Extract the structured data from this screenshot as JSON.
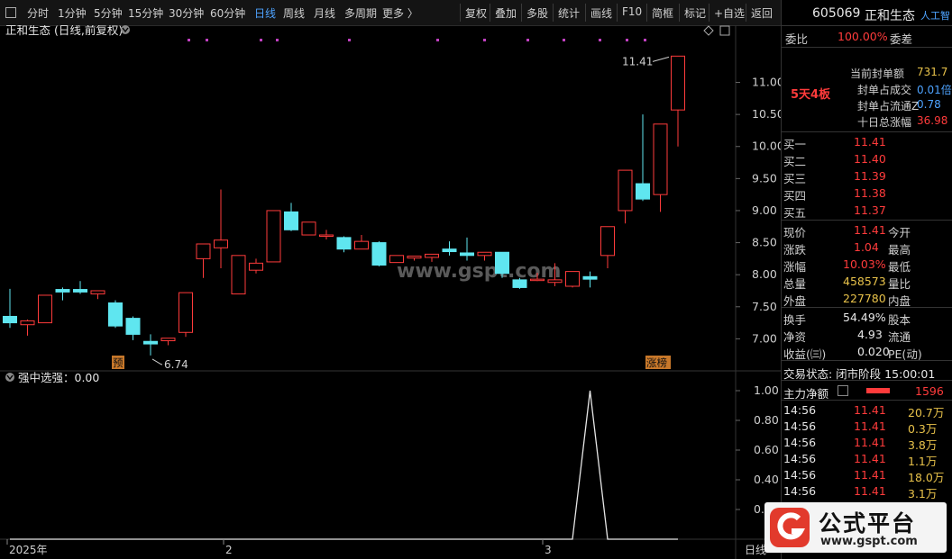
{
  "toolbar": {
    "items": [
      "分时",
      "1分钟",
      "5分钟",
      "15分钟",
      "30分钟",
      "60分钟",
      "日线",
      "周线",
      "月线",
      "多周期",
      "更多 〉"
    ],
    "active_index": 6,
    "right_items": [
      "复权",
      "叠加",
      "多股",
      "统计",
      "画线",
      "F10",
      "简框",
      "标记",
      "+自选",
      "返回"
    ]
  },
  "chart_title": "正和生态 (日线,前复权)",
  "indicator_title": "强中选强：0.00",
  "candles": [
    {
      "o": 7.35,
      "h": 7.78,
      "c": 7.25,
      "l": 7.17
    },
    {
      "o": 7.22,
      "h": 7.3,
      "c": 7.28,
      "l": 7.05
    },
    {
      "o": 7.25,
      "h": 7.68,
      "c": 7.68,
      "l": 7.25
    },
    {
      "o": 7.77,
      "h": 7.8,
      "c": 7.73,
      "l": 7.6
    },
    {
      "o": 7.77,
      "h": 7.9,
      "c": 7.73,
      "l": 7.7
    },
    {
      "o": 7.7,
      "h": 7.75,
      "c": 7.75,
      "l": 7.62
    },
    {
      "o": 7.56,
      "h": 7.6,
      "c": 7.2,
      "l": 7.17
    },
    {
      "o": 7.32,
      "h": 7.35,
      "c": 7.07,
      "l": 6.98
    },
    {
      "o": 6.96,
      "h": 7.07,
      "c": 6.92,
      "l": 6.74
    },
    {
      "o": 6.97,
      "h": 7.01,
      "c": 7.01,
      "l": 6.9
    },
    {
      "o": 7.1,
      "h": 7.72,
      "c": 7.72,
      "l": 7.03
    },
    {
      "o": 8.25,
      "h": 8.48,
      "c": 8.48,
      "l": 7.95
    },
    {
      "o": 8.42,
      "h": 9.33,
      "c": 8.54,
      "l": 8.1
    },
    {
      "o": 7.7,
      "h": 8.3,
      "c": 8.3,
      "l": 7.7
    },
    {
      "o": 8.07,
      "h": 8.25,
      "c": 8.18,
      "l": 8.02
    },
    {
      "o": 8.2,
      "h": 9.0,
      "c": 9.0,
      "l": 8.2
    },
    {
      "o": 8.98,
      "h": 9.12,
      "c": 8.7,
      "l": 8.68
    },
    {
      "o": 8.62,
      "h": 8.82,
      "c": 8.82,
      "l": 8.62
    },
    {
      "o": 8.62,
      "h": 8.7,
      "c": 8.62,
      "l": 8.55
    },
    {
      "o": 8.58,
      "h": 8.6,
      "c": 8.4,
      "l": 8.35
    },
    {
      "o": 8.4,
      "h": 8.62,
      "c": 8.52,
      "l": 8.4
    },
    {
      "o": 8.5,
      "h": 8.52,
      "c": 8.15,
      "l": 8.13
    },
    {
      "o": 8.19,
      "h": 8.3,
      "c": 8.3,
      "l": 8.19
    },
    {
      "o": 8.26,
      "h": 8.29,
      "c": 8.29,
      "l": 8.22
    },
    {
      "o": 8.27,
      "h": 8.32,
      "c": 8.32,
      "l": 8.2
    },
    {
      "o": 8.4,
      "h": 8.52,
      "c": 8.36,
      "l": 8.3
    },
    {
      "o": 8.34,
      "h": 8.58,
      "c": 8.3,
      "l": 8.22
    },
    {
      "o": 8.3,
      "h": 8.35,
      "c": 8.35,
      "l": 8.22
    },
    {
      "o": 8.35,
      "h": 8.35,
      "c": 8.02,
      "l": 7.95
    },
    {
      "o": 7.92,
      "h": 7.95,
      "c": 7.8,
      "l": 7.78
    },
    {
      "o": 7.93,
      "h": 8.03,
      "c": 7.93,
      "l": 7.9
    },
    {
      "o": 7.88,
      "h": 8.18,
      "c": 7.92,
      "l": 7.82
    },
    {
      "o": 7.82,
      "h": 8.05,
      "c": 8.05,
      "l": 7.8
    },
    {
      "o": 7.97,
      "h": 8.05,
      "c": 7.93,
      "l": 7.8
    },
    {
      "o": 8.3,
      "h": 8.75,
      "c": 8.75,
      "l": 8.1
    },
    {
      "o": 9.0,
      "h": 9.63,
      "c": 9.63,
      "l": 8.8
    },
    {
      "o": 9.42,
      "h": 10.5,
      "c": 9.18,
      "l": 9.15
    },
    {
      "o": 9.25,
      "h": 10.35,
      "c": 10.35,
      "l": 8.98
    },
    {
      "o": 10.57,
      "h": 11.41,
      "c": 11.41,
      "l": 10.0
    }
  ],
  "markers": {
    "high_label": "11.41",
    "low_label": "6.74",
    "tag_pre": "预",
    "tag_rank": "涨榜"
  },
  "price_axis": [
    "11.00",
    "10.50",
    "10.00",
    "9.50",
    "9.00",
    "8.50",
    "8.00",
    "7.50",
    "7.00"
  ],
  "indicator_axis": [
    "1.00",
    "0.80",
    "0.60",
    "0.40",
    "0.2"
  ],
  "indicator_values": [
    0,
    0,
    0,
    0,
    0,
    0,
    0,
    0,
    0,
    0,
    0,
    0,
    0,
    0,
    0,
    0,
    0,
    0,
    0,
    0,
    0,
    0,
    0,
    0,
    0,
    0,
    0,
    0,
    0,
    0,
    0,
    0,
    0,
    1,
    0,
    0,
    0,
    0,
    0
  ],
  "x_axis": {
    "labels": [
      "2025年",
      "2",
      "3"
    ],
    "right_label": "日线"
  },
  "watermark_text": "www.gspt.com",
  "panel": {
    "code": "605069",
    "name": "正和生态",
    "ai_label": "人工智",
    "weibi_label": "委比",
    "weibi_value": "100.00%",
    "weicha_label": "委差",
    "streak": "5天4板",
    "seal_lines": [
      {
        "label": "当前封单额",
        "value": "731.7"
      },
      {
        "label": "封单占成交",
        "value": "0.01倍"
      },
      {
        "label": "封单占流通Z",
        "value": "0.78"
      },
      {
        "label": "十日总涨幅",
        "value": "36.98"
      }
    ],
    "bids": [
      {
        "label": "买一",
        "price": "11.41"
      },
      {
        "label": "买二",
        "price": "11.40"
      },
      {
        "label": "买三",
        "price": "11.39"
      },
      {
        "label": "买四",
        "price": "11.38"
      },
      {
        "label": "买五",
        "price": "11.37"
      }
    ],
    "quote": [
      {
        "l1": "现价",
        "v1": "11.41",
        "l2": "今开"
      },
      {
        "l1": "涨跌",
        "v1": "1.04",
        "l2": "最高"
      },
      {
        "l1": "涨幅",
        "v1": "10.03%",
        "l2": "最低"
      },
      {
        "l1": "总量",
        "v1": "458573",
        "l2": "量比"
      },
      {
        "l1": "外盘",
        "v1": "227780",
        "l2": "内盘"
      }
    ],
    "stats": [
      {
        "l1": "换手",
        "v1": "54.49%",
        "l2": "股本"
      },
      {
        "l1": "净资",
        "v1": "4.93",
        "l2": "流通"
      },
      {
        "l1": "收益(㈢)",
        "v1": "0.020",
        "l2": "PE(动)"
      }
    ],
    "trade_status": "交易状态: 闭市阶段 15:00:01",
    "main_flow_label": "主力净额",
    "main_flow_value": "1596",
    "ticks": [
      {
        "time": "14:56",
        "price": "11.41",
        "vol": "20.7万"
      },
      {
        "time": "14:56",
        "price": "11.41",
        "vol": "0.3万"
      },
      {
        "time": "14:56",
        "price": "11.41",
        "vol": "3.8万"
      },
      {
        "time": "14:56",
        "price": "11.41",
        "vol": "1.1万"
      },
      {
        "time": "14:56",
        "price": "11.41",
        "vol": "18.0万"
      },
      {
        "time": "14:56",
        "price": "11.41",
        "vol": "3.1万"
      }
    ]
  },
  "logo": {
    "name": "公式平台",
    "url": "www.gspt.com"
  },
  "colors": {
    "up": "#ff3b3b",
    "down": "#5fe6f0",
    "magenta": "#c040c0"
  }
}
